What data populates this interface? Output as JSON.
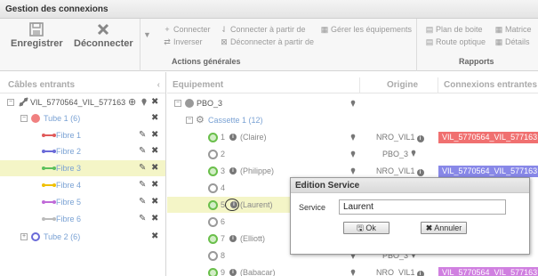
{
  "window": {
    "title": "Gestion des connexions"
  },
  "ribbon": {
    "save_label": "Enregistrer",
    "disconnect_label": "Déconnecter",
    "connect_label": "Connecter",
    "invert_label": "Inverser",
    "connect_from_label": "Connecter à partir de",
    "disconnect_from_label": "Déconnecter à partir de",
    "manage_equipment_label": "Gérer les équipements",
    "group_actions_label": "Actions générales",
    "box_plan_label": "Plan de boite",
    "optical_route_label": "Route optique",
    "matrix_label": "Matrice",
    "details_label": "Détails",
    "group_reports_label": "Rapports"
  },
  "left_panel": {
    "header": "Câbles entrants",
    "cable_label": "VIL_5770564_VIL_577163",
    "tube1_label": "Tube 1 (6)",
    "tube2_label": "Tube 2 (6)",
    "fibers": [
      {
        "label": "Fibre 1",
        "color": "#e05a5a"
      },
      {
        "label": "Fibre 2",
        "color": "#6a6ad8"
      },
      {
        "label": "Fibre 3",
        "color": "#5cc05c"
      },
      {
        "label": "Fibre 4",
        "color": "#f0c000"
      },
      {
        "label": "Fibre 5",
        "color": "#c06ad8"
      },
      {
        "label": "Fibre 6",
        "color": "#bbbbbb"
      }
    ]
  },
  "right_panel": {
    "col_equipment": "Equipement",
    "col_origin": "Origine",
    "col_connections": "Connexions entrantes",
    "pbo_label": "PBO_3",
    "cassette_label": "Cassette 1 (12)",
    "ports": [
      {
        "num": "1",
        "name": "(Claire)",
        "origin": "NRO_VIL1",
        "conn": "VIL_5770564_VIL_577163",
        "conn_color": "#f07070"
      },
      {
        "num": "2",
        "name": "",
        "origin": "PBO_3",
        "conn": "",
        "conn_color": ""
      },
      {
        "num": "3",
        "name": "(Philippe)",
        "origin": "NRO_VIL1",
        "conn": "VIL_5770564_VIL_577163",
        "conn_color": "#8888e8"
      },
      {
        "num": "4",
        "name": "",
        "origin": "",
        "conn": "",
        "conn_color": ""
      },
      {
        "num": "5",
        "name": "(Laurent)",
        "origin": "",
        "conn": "",
        "conn_color": ""
      },
      {
        "num": "6",
        "name": "",
        "origin": "",
        "conn": "",
        "conn_color": ""
      },
      {
        "num": "7",
        "name": "(Elliott)",
        "origin": "",
        "conn": "",
        "conn_color": ""
      },
      {
        "num": "8",
        "name": "",
        "origin": "PBO_3",
        "conn": "",
        "conn_color": ""
      },
      {
        "num": "9",
        "name": "(Babacar)",
        "origin": "NRO_VIL1",
        "conn": "VIL_5770564_VIL_577163",
        "conn_color": "#d080e0"
      }
    ]
  },
  "modal": {
    "title": "Edition Service",
    "service_label": "Service",
    "service_value": "Laurent",
    "ok_label": "Ok",
    "cancel_label": "Annuler"
  }
}
